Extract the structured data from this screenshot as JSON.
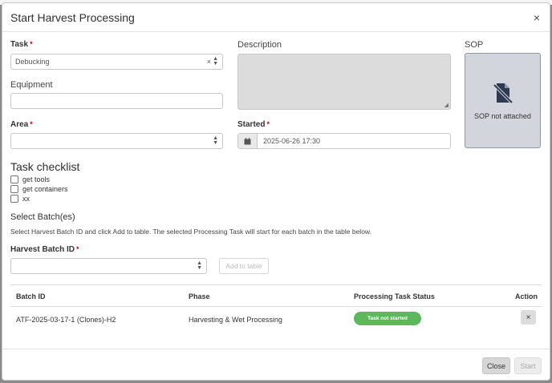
{
  "modal": {
    "title": "Start Harvest Processing",
    "close_icon": "×"
  },
  "form": {
    "task": {
      "label": "Task",
      "required_mark": "*",
      "value": "Debucking",
      "clear_icon": "×"
    },
    "description": {
      "label": "Description"
    },
    "sop": {
      "label": "SOP",
      "status_text": "SOP not attached",
      "icon": "file-slash-icon"
    },
    "equipment": {
      "label": "Equipment"
    },
    "area": {
      "label": "Area",
      "required_mark": "*"
    },
    "started": {
      "label": "Started",
      "required_mark": "*",
      "value": "2025-06-26 17:30",
      "icon": "calendar-icon"
    }
  },
  "checklist": {
    "title": "Task checklist",
    "items": [
      "get tools",
      "get containers",
      "xx"
    ]
  },
  "batches": {
    "title": "Select Batch(es)",
    "help_text": "Select Harvest Batch ID and click Add to table. The selected Processing Task will start for each batch in the table below.",
    "batch_id_label": "Harvest Batch ID",
    "batch_id_required_mark": "*",
    "add_button": "Add to table"
  },
  "table": {
    "headers": [
      "Batch ID",
      "Phase",
      "Processing Task Status",
      "Action"
    ],
    "rows": [
      {
        "batch_id": "ATF-2025-03-17-1 (Clones)-H2",
        "phase": "Harvesting & Wet Processing",
        "status": "Task not started",
        "action_icon": "×"
      }
    ]
  },
  "footer": {
    "close_button": "Close",
    "start_button": "Start"
  },
  "colors": {
    "status_green": "#5cb85c",
    "sop_box": "#d3d5dc",
    "required_red": "#cc0000"
  }
}
